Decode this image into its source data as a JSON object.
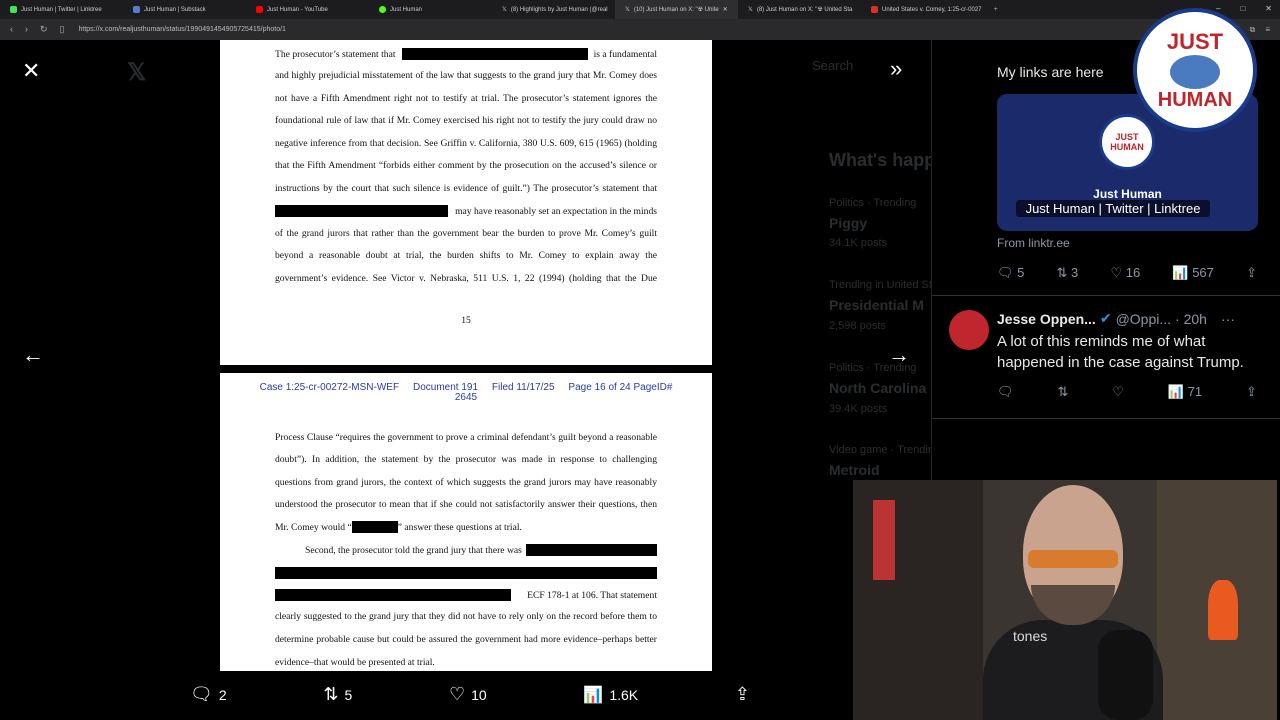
{
  "browser": {
    "tabs": [
      {
        "title": "Just Human | Twitter | Linktree",
        "color": "#43e55e"
      },
      {
        "title": "Just Human | Substack",
        "color": "#5b7ad0"
      },
      {
        "title": "Just Human - YouTube",
        "color": "#ff0000"
      },
      {
        "title": "Just Human",
        "color": "#53fc18"
      },
      {
        "title": "(8) Highlights by Just Human (@real",
        "color": "#ffffff"
      },
      {
        "title": "(10) Just Human on X: \"☢ Unite",
        "color": "#ffffff"
      },
      {
        "title": "(8) Just Human on X: \"☢ United Sta",
        "color": "#ffffff"
      },
      {
        "title": "United States v. Comey, 1:25-cr-0027",
        "color": "#d93025"
      }
    ],
    "url": "https://x.com/realjusthuman/status/1990491454905725415/photo/1"
  },
  "background_ui": {
    "search": "Search",
    "heading": "What's happening",
    "trend1_cat": "Politics · Trending",
    "trend1": "Piggy",
    "trend1_posts": "34.1K posts",
    "trend2_cat": "Trending in United States",
    "trend2": "Presidential M",
    "trend2_posts": "2,598 posts",
    "trend3_cat": "Politics · Trending",
    "trend3": "North Carolina",
    "trend3_posts": "39.4K posts",
    "trend4_cat": "Video game · Trending",
    "trend4": "Metroid"
  },
  "document": {
    "page1": {
      "lines": [
        [
          "The prosecutor’s statement that",
          "is a fundamental"
        ],
        "and highly prejudicial misstatement of the law that suggests to the grand jury that Mr. Comey does",
        "not have a Fifth Amendment right not to testify at trial. The prosecutor’s statement ignores the",
        "foundational rule of law that if Mr. Comey exercised his right not to testify the jury could draw no",
        "negative inference from that decision. See Griffin v. California, 380 U.S. 609, 615 (1965) (holding",
        "that the Fifth Amendment “forbids either comment by the prosecution on the accused’s silence or",
        "instructions by the court that such silence is evidence of guilt.”)  The prosecutor’s statement that",
        "may have reasonably set an expectation in the minds",
        "of the grand jurors that rather than the government bear the burden to prove Mr. Comey’s guilt",
        "beyond a reasonable doubt at trial, the burden shifts to Mr. Comey to explain away the",
        "government’s evidence. See Victor v. Nebraska, 511 U.S. 1, 22 (1994) (holding that the Due"
      ],
      "page_number": "15"
    },
    "page2": {
      "header": "Case 1:25-cr-00272-MSN-WEF     Document 191     Filed 11/17/25     Page 16 of 24 PageID#",
      "header2": "2645",
      "lines": [
        "Process Clause “requires the government to prove a criminal defendant’s guilt beyond a reasonable",
        "doubt”).  In addition, the statement by the prosecutor was made in response to challenging",
        "questions from grand jurors, the context of which suggests the grand jurors may have reasonably",
        "understood the prosecutor to mean that if she could not satisfactorily answer their questions, then",
        [
          "Mr. Comey would “",
          "” answer these questions at trial."
        ],
        "Second, the prosecutor told the grand jury that there was",
        "ECF 178-1 at 106.  That statement",
        "clearly suggested to the grand jury that they did not have to rely only on the record before them to",
        "determine probable cause but could be assured the government had more evidence–perhaps better",
        "evidence–that would be presented at trial."
      ]
    }
  },
  "post_actions": {
    "replies": "2",
    "reposts": "5",
    "likes": "10",
    "views": "1.6K"
  },
  "right_panel": {
    "tweet_text": "My links are here",
    "card_logo": "JUST HUMAN",
    "card_title": "Just Human",
    "card_subtitle": "Just Human | Twitter | Linktree",
    "card_source": "From linktr.ee",
    "stats": {
      "replies": "5",
      "reposts": "3",
      "likes": "16",
      "views": "567"
    },
    "reply": {
      "name": "Jesse Oppen...",
      "handle": "@Oppi...",
      "time": "· 20h",
      "text": "A lot of this reminds me of what happened in the case against Trump.",
      "views": "71"
    }
  },
  "overlay_logo": {
    "top": "JUST",
    "bottom": "HUMAN"
  },
  "webcam": {
    "shirt_text": "tones"
  },
  "colors": {
    "accent": "#1d9bf0",
    "card": "#1b2a6b",
    "redaction": "#000000",
    "doc_header": "#2b3aa8"
  }
}
